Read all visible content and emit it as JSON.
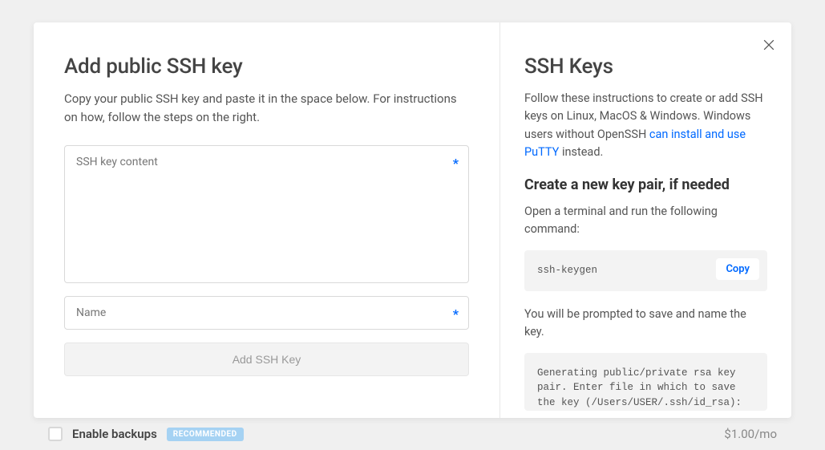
{
  "background": {
    "enable_backups_label": "Enable backups",
    "recommended_badge": "RECOMMENDED",
    "price": "$1.00/mo"
  },
  "modal": {
    "left": {
      "title": "Add public SSH key",
      "subtitle": "Copy your public SSH key and paste it in the space below. For instructions on how, follow the steps on the right.",
      "content_field_label": "SSH key content",
      "content_field_value": "",
      "name_field_label": "Name",
      "name_field_value": "",
      "submit_label": "Add SSH Key"
    },
    "right": {
      "title": "SSH Keys",
      "intro_prefix": "Follow these instructions to create or add SSH keys on Linux, MacOS & Windows. Windows users without OpenSSH ",
      "intro_link": "can install and use PuTTY",
      "intro_suffix": " instead.",
      "section_title": "Create a new key pair, if needed",
      "section_para": "Open a terminal and run the following command:",
      "command": "ssh-keygen",
      "copy_label": "Copy",
      "prompt_para": "You will be prompted to save and name the key.",
      "output_block": "Generating public/private rsa key pair. Enter file in which to save the key (/Users/USER/.ssh/id_rsa):"
    }
  }
}
